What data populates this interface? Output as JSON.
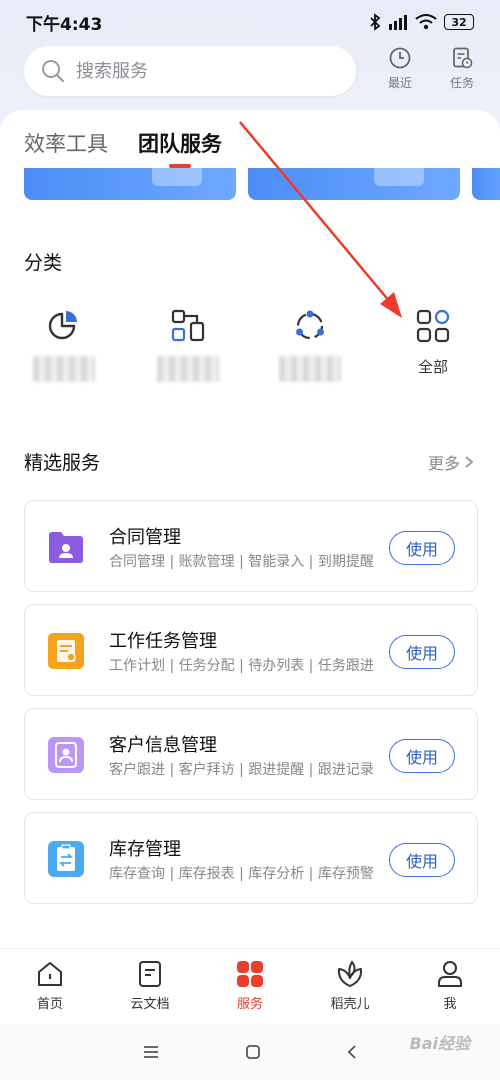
{
  "status_bar": {
    "time": "下午4:43",
    "battery": "32"
  },
  "search": {
    "placeholder": "搜索服务"
  },
  "header": {
    "recent_label": "最近",
    "tasks_label": "任务"
  },
  "tabs": [
    {
      "label": "效率工具",
      "active": false
    },
    {
      "label": "团队服务",
      "active": true
    }
  ],
  "categories": {
    "title": "分类",
    "items": [
      {
        "icon": "pie-chart-icon",
        "label": ""
      },
      {
        "icon": "flow-chart-icon",
        "label": ""
      },
      {
        "icon": "team-circle-icon",
        "label": ""
      },
      {
        "icon": "grid-all-icon",
        "label": "全部"
      }
    ]
  },
  "featured": {
    "title": "精选服务",
    "more_label": "更多",
    "services": [
      {
        "icon": "contract-folder-icon",
        "title": "合同管理",
        "desc": "合同管理 | 账款管理 | 智能录入 | 到期提醒",
        "button": "使用",
        "color": "#8c5ce0"
      },
      {
        "icon": "task-clipboard-icon",
        "title": "工作任务管理",
        "desc": "工作计划 | 任务分配 | 待办列表 | 任务跟进",
        "button": "使用",
        "color": "#f5a21c"
      },
      {
        "icon": "customer-book-icon",
        "title": "客户信息管理",
        "desc": "客户跟进 | 客户拜访 | 跟进提醒 | 跟进记录",
        "button": "使用",
        "color": "#9a6ff0"
      },
      {
        "icon": "inventory-clipboard-icon",
        "title": "库存管理",
        "desc": "库存查询 | 库存报表 | 库存分析 | 库存预警",
        "button": "使用",
        "color": "#3fa2f0"
      }
    ]
  },
  "bottom_nav": [
    {
      "icon": "home-icon",
      "label": "首页",
      "active": false
    },
    {
      "icon": "document-icon",
      "label": "云文档",
      "active": false
    },
    {
      "icon": "services-grid-icon",
      "label": "服务",
      "active": true
    },
    {
      "icon": "leaf-icon",
      "label": "稻壳儿",
      "active": false
    },
    {
      "icon": "person-icon",
      "label": "我",
      "active": false
    }
  ],
  "colors": {
    "accent": "#e8402a",
    "primary_blue": "#3b6fd8"
  },
  "watermark": "Bai经验"
}
